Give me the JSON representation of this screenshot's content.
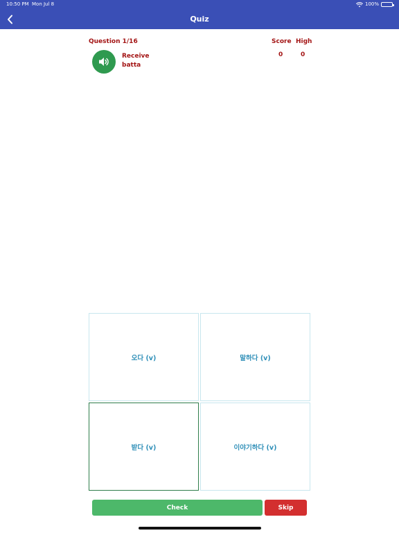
{
  "status_bar": {
    "time": "10:50 PM",
    "date": "Mon Jul 8",
    "battery": "100%",
    "wifi_icon": "wifi-icon",
    "battery_icon": "battery-icon",
    "battery_level": 1.0
  },
  "nav": {
    "title": "Quiz",
    "back_icon": "chevron-left-icon"
  },
  "quiz": {
    "question_label": "Question 1/16",
    "score_label": "Score",
    "high_label": "High",
    "score_value": "0",
    "high_value": "0",
    "prompt_word": "Receive",
    "prompt_romanized": "batta",
    "speaker_icon": "speaker-icon"
  },
  "options": [
    {
      "label": "오다 (v)"
    },
    {
      "label": "말하다 (v)"
    },
    {
      "label": "받다 (v)"
    },
    {
      "label": "이야기하다 (v)"
    }
  ],
  "actions": {
    "check_label": "Check",
    "skip_label": "Skip"
  },
  "colors": {
    "header": "#3a4fb6",
    "question_text": "#a31414",
    "option_text": "#2f8fb8",
    "check_button": "#4db86a",
    "skip_button": "#d32f2f",
    "speaker_button": "#2f9a4f",
    "selected_border": "#2e7d4a"
  }
}
